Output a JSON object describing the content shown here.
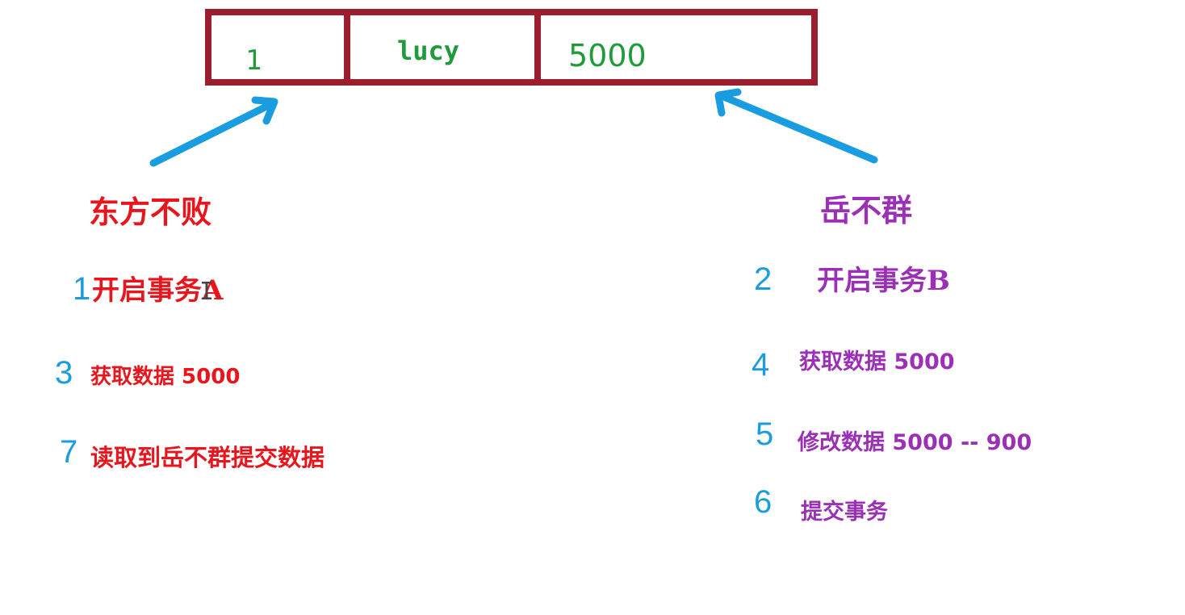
{
  "record": {
    "id": "1",
    "name": "lucy",
    "money": "5000"
  },
  "left": {
    "user": "东方不败",
    "steps": [
      {
        "num": "1",
        "text": "开启事务A"
      },
      {
        "num": "3",
        "text": "获取数据 5000"
      },
      {
        "num": "7",
        "text": "读取到岳不群提交数据"
      }
    ]
  },
  "right": {
    "user": "岳不群",
    "steps": [
      {
        "num": "2",
        "text": "开启事务B"
      },
      {
        "num": "4",
        "text": "获取数据 5000"
      },
      {
        "num": "5",
        "text": "修改数据 5000 -- 900"
      },
      {
        "num": "6",
        "text": "提交事务"
      }
    ]
  },
  "colors": {
    "border": "#9b1d2e",
    "cell_text": "#1f9b3c",
    "left_text": "#e8161c",
    "right_text": "#9b2fb5",
    "step_number": "#1a9de0",
    "arrow": "#1a9de0"
  }
}
